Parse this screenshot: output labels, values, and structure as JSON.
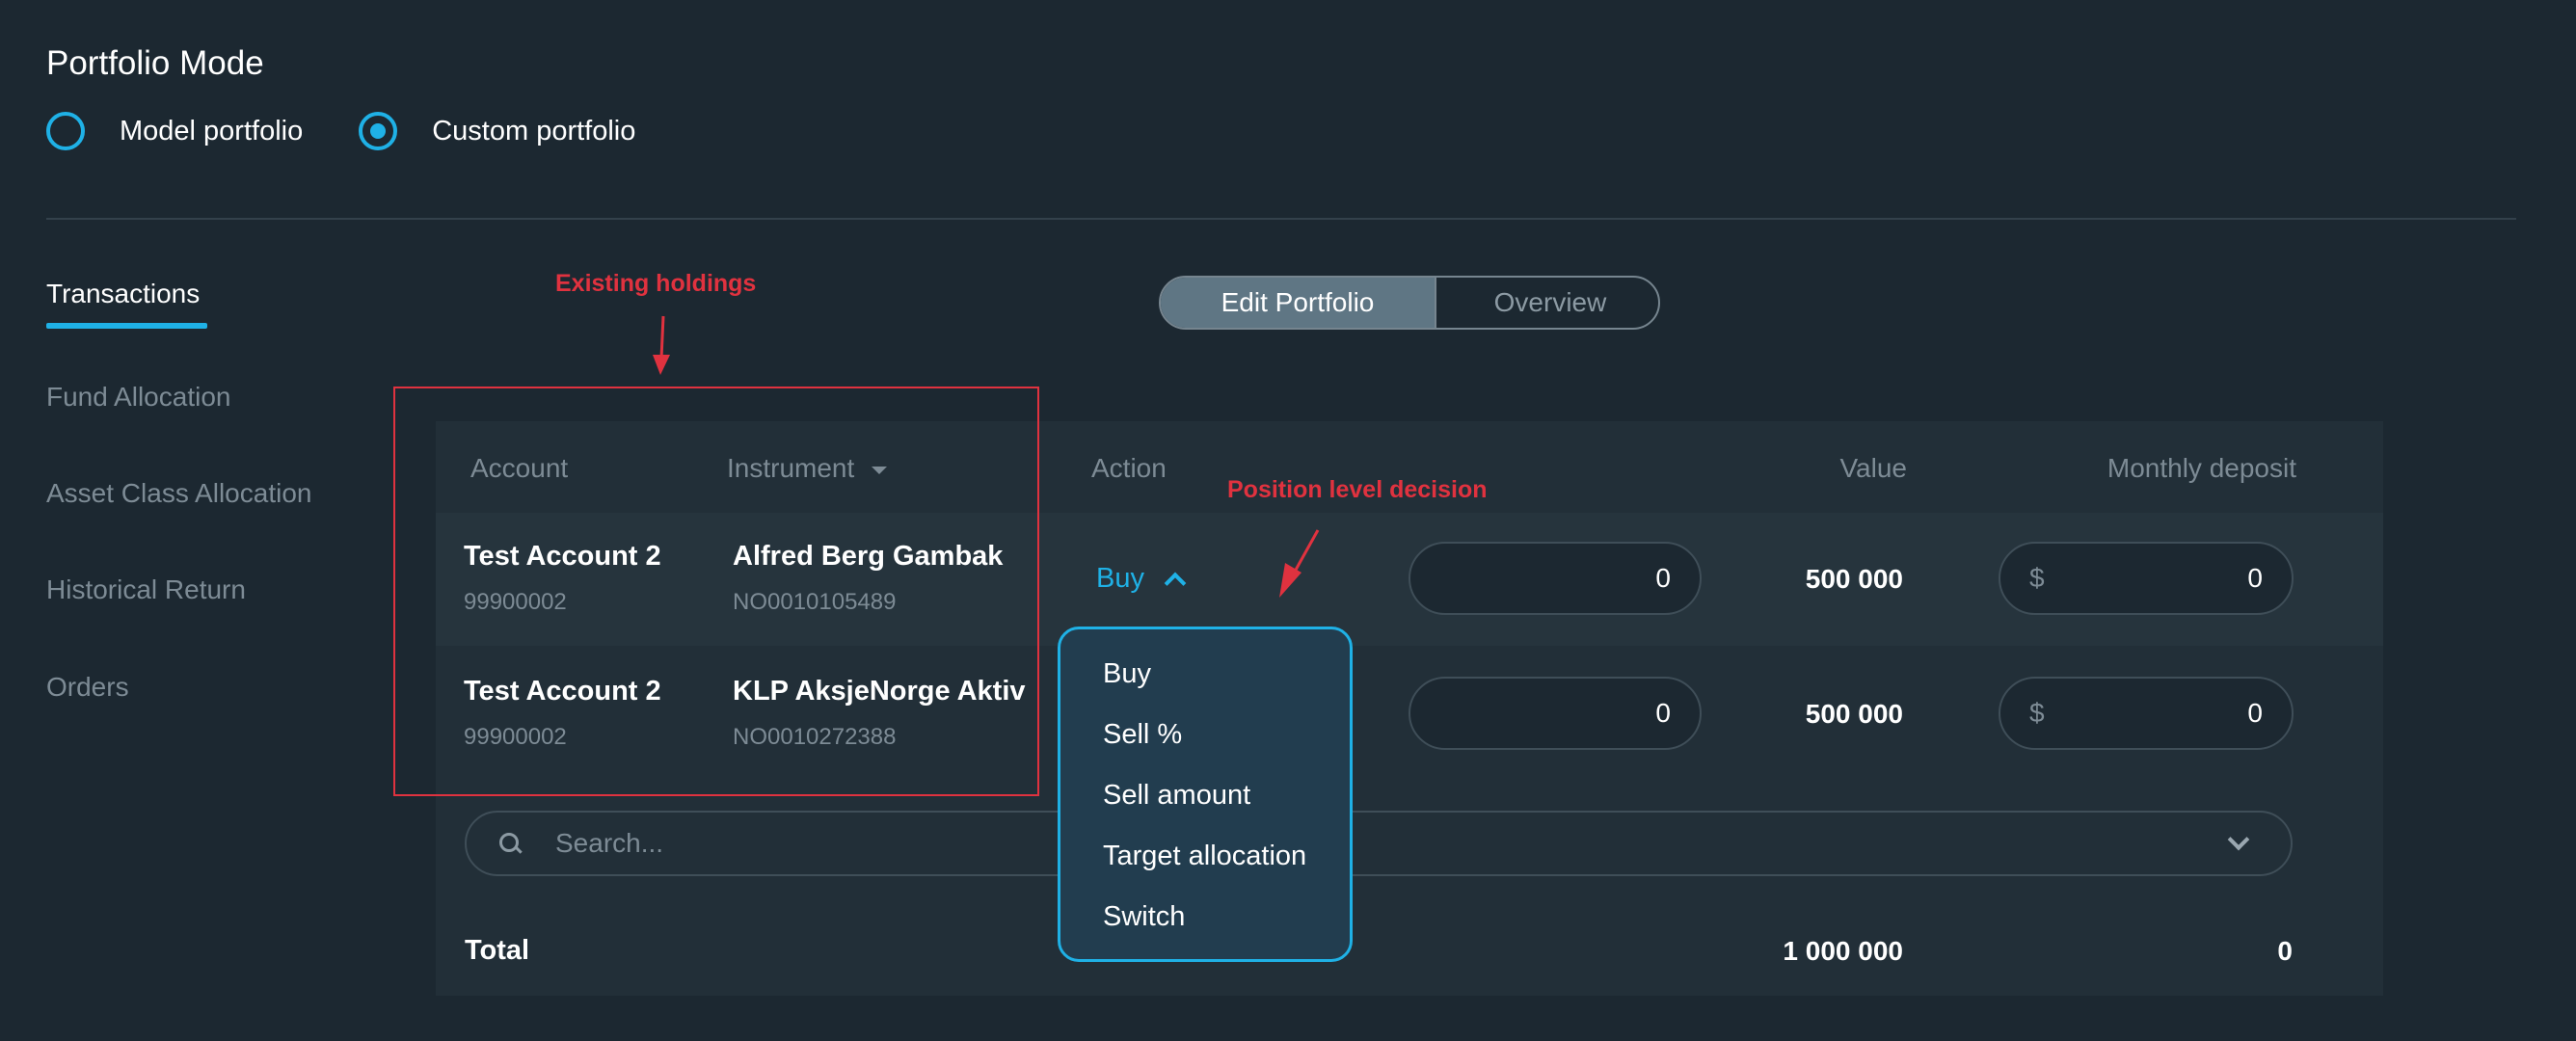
{
  "portfolio_mode": {
    "title": "Portfolio Mode",
    "options": [
      {
        "label": "Model portfolio",
        "selected": false
      },
      {
        "label": "Custom portfolio",
        "selected": true
      }
    ]
  },
  "sidebar": {
    "items": [
      {
        "label": "Transactions",
        "active": true
      },
      {
        "label": "Fund Allocation",
        "active": false
      },
      {
        "label": "Asset Class Allocation",
        "active": false
      },
      {
        "label": "Historical Return",
        "active": false
      },
      {
        "label": "Orders",
        "active": false
      }
    ]
  },
  "view_toggle": {
    "options": [
      "Edit Portfolio",
      "Overview"
    ],
    "selected": "Edit Portfolio"
  },
  "table": {
    "columns": [
      "Account",
      "Instrument",
      "Action",
      "Value",
      "Monthly deposit"
    ],
    "rows": [
      {
        "account_name": "Test Account 2",
        "account_number": "99900002",
        "instrument_name": "Alfred Berg Gambak",
        "isin": "NO0010105489",
        "action": "Buy",
        "amount": "0",
        "value": "500 000",
        "deposit_prefix": "$",
        "monthly_deposit": "0"
      },
      {
        "account_name": "Test Account 2",
        "account_number": "99900002",
        "instrument_name": "KLP AksjeNorge Aktiv",
        "isin": "NO0010272388",
        "action": "",
        "amount": "0",
        "value": "500 000",
        "deposit_prefix": "$",
        "monthly_deposit": "0"
      }
    ],
    "search_placeholder": "Search...",
    "total_label": "Total",
    "total_value": "1 000 000",
    "total_deposit": "0"
  },
  "action_menu": {
    "open": true,
    "items": [
      "Buy",
      "Sell %",
      "Sell amount",
      "Target allocation",
      "Switch"
    ]
  },
  "annotations": {
    "existing_holdings": "Existing holdings",
    "position_level": "Position level decision"
  },
  "colors": {
    "background": "#1c2831",
    "panel": "#222f38",
    "accent": "#1fb1e6",
    "annotation": "#e0323f",
    "muted_text": "#7d8b95"
  }
}
